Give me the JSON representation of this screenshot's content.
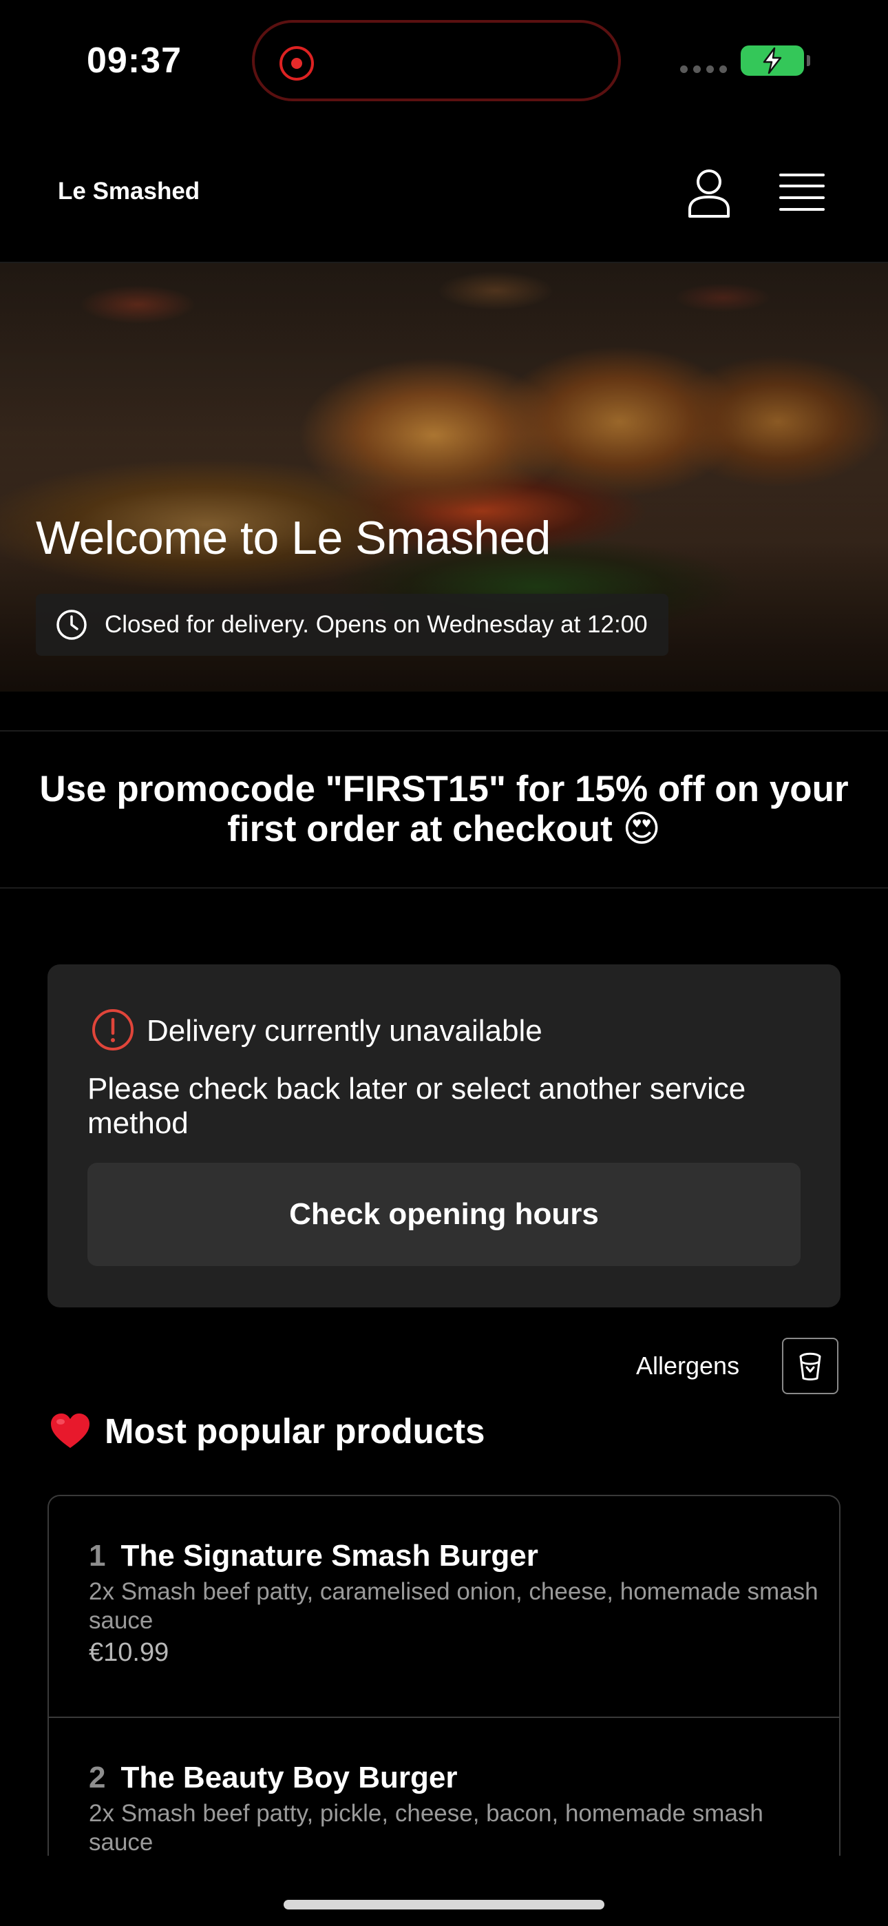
{
  "status_bar": {
    "time": "09:37"
  },
  "header": {
    "brand": "Le Smashed",
    "icons": [
      "user-icon",
      "menu-icon"
    ]
  },
  "hero": {
    "title": "Welcome to Le Smashed",
    "status": "Closed for delivery. Opens on Wednesday at 12:00",
    "status_icon": "clock-icon"
  },
  "promo": {
    "text": "Use promocode \"FIRST15\" for 15% off on your first order at checkout 😍"
  },
  "delivery": {
    "icon": "info-icon",
    "title": "Delivery currently unavailable",
    "description": "Please check back later or select another service method",
    "button": "Check opening hours"
  },
  "allergens": {
    "label": "Allergens",
    "icon": "allergens-icon"
  },
  "popular": {
    "heading": "Most popular products",
    "icon": "heart-icon",
    "products": [
      {
        "rank": "1",
        "name": "The Signature Smash Burger",
        "description": "2x Smash beef patty, caramelised onion, cheese, homemade smash sauce",
        "price": "€10.99"
      },
      {
        "rank": "2",
        "name": "The Beauty Boy Burger",
        "description": "2x Smash beef patty, pickle, cheese, bacon, homemade smash sauce"
      }
    ]
  },
  "colors": {
    "background": "#000000",
    "card": "#222222",
    "button": "#303030",
    "accent_red": "#e0453a",
    "battery_green": "#34c759"
  }
}
